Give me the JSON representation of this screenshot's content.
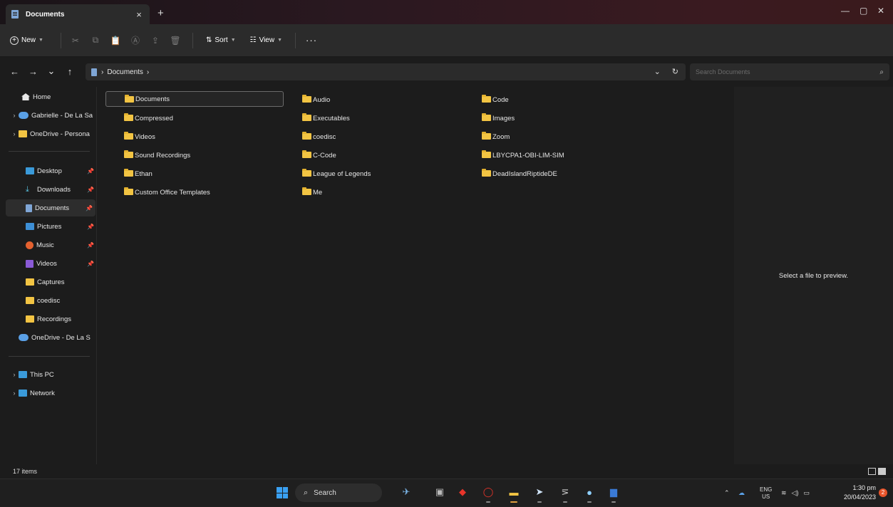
{
  "tab": {
    "title": "Documents",
    "close": "×",
    "new": "+"
  },
  "window_controls": {
    "minimize": "—",
    "maximize": "▢",
    "close": "✕"
  },
  "toolbar": {
    "new_label": "New",
    "sort_label": "Sort",
    "view_label": "View",
    "more_label": "···"
  },
  "address": {
    "breadcrumb": "Documents",
    "separator": "›"
  },
  "search": {
    "placeholder": "Search Documents"
  },
  "sidebar": {
    "top": [
      {
        "label": "Home"
      },
      {
        "label": "Gabrielle - De La Sa"
      },
      {
        "label": "OneDrive - Persona"
      }
    ],
    "quick": [
      {
        "label": "Desktop"
      },
      {
        "label": "Downloads"
      },
      {
        "label": "Documents"
      },
      {
        "label": "Pictures"
      },
      {
        "label": "Music"
      },
      {
        "label": "Videos"
      },
      {
        "label": "Captures"
      },
      {
        "label": "coedisc"
      },
      {
        "label": "Recordings"
      },
      {
        "label": "OneDrive - De La S"
      }
    ],
    "bottom": [
      {
        "label": "This PC"
      },
      {
        "label": "Network"
      }
    ]
  },
  "files": [
    {
      "name": "Documents"
    },
    {
      "name": "Compressed"
    },
    {
      "name": "Videos"
    },
    {
      "name": "Sound Recordings"
    },
    {
      "name": "Ethan"
    },
    {
      "name": "Custom Office Templates"
    },
    {
      "name": "Audio"
    },
    {
      "name": "Executables"
    },
    {
      "name": "coedisc"
    },
    {
      "name": "C-Code"
    },
    {
      "name": "League of Legends"
    },
    {
      "name": "Me"
    },
    {
      "name": "Code"
    },
    {
      "name": "Images"
    },
    {
      "name": "Zoom"
    },
    {
      "name": "LBYCPA1-OBI-LIM-SIM"
    },
    {
      "name": "DeadIslandRiptideDE"
    }
  ],
  "preview": {
    "message": "Select a file to preview."
  },
  "status": {
    "count": "17 items"
  },
  "taskbar": {
    "search_label": "Search",
    "lang_top": "ENG",
    "lang_bottom": "US",
    "time": "1:30 pm",
    "date": "20/04/2023",
    "notifications": "2"
  }
}
